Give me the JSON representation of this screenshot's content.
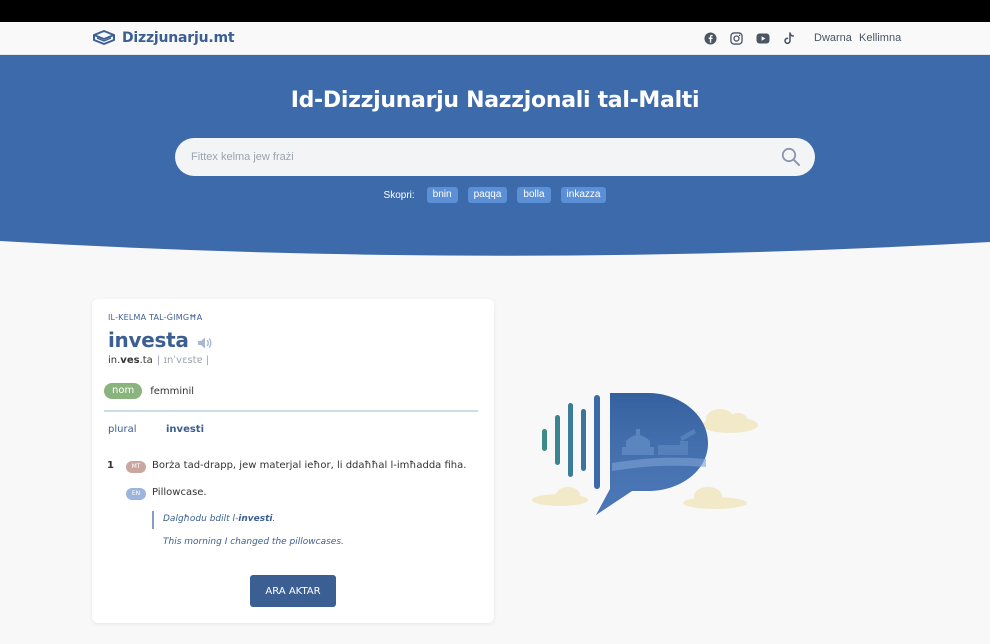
{
  "nav": {
    "logo_text": "Dizzjunarju.mt",
    "links": [
      "Dwarna",
      "Kellimna"
    ],
    "social_icons": [
      "facebook-icon",
      "instagram-icon",
      "youtube-icon",
      "tiktok-icon"
    ]
  },
  "hero": {
    "title": "Id-Dizzjunarju Nazzjonali tal-Malti",
    "search_placeholder": "Fittex kelma jew frażi",
    "discover_label": "Skopri:",
    "suggestions": [
      "bnin",
      "paqqa",
      "bolla",
      "inkazza"
    ]
  },
  "word_card": {
    "eyebrow": "IL-KELMA TAL-ĠIMGĦA",
    "word": "investa",
    "syllables_pre": "in.",
    "syllables_stress": "ves",
    "syllables_post": ".ta",
    "ipa": "| ɪnˈvɛstɐ |",
    "pos": "nom",
    "gender": "femminil",
    "plural_label": "plural",
    "plural_value": "investi",
    "sense_number": "1",
    "mt_badge": "MT",
    "en_badge": "EN",
    "definition_mt": "Borża tad-drapp, jew materjal ieħor, li ddaħħal l-imħadda fiha.",
    "definition_en": "Pillowcase.",
    "example_mt_pre": "Dalgħodu bdilt l-",
    "example_mt_bold": "investi",
    "example_mt_post": ".",
    "example_en": "This morning I changed the pillowcases.",
    "more_button": "ARA AKTAR"
  },
  "colors": {
    "brand": "#3c5f93",
    "hero_bg": "#3d6aab",
    "chip_bg": "#5b8fd6",
    "pos_badge": "#8ab47d",
    "mt_badge": "#c8a7a1",
    "en_badge": "#9bb5dd"
  }
}
